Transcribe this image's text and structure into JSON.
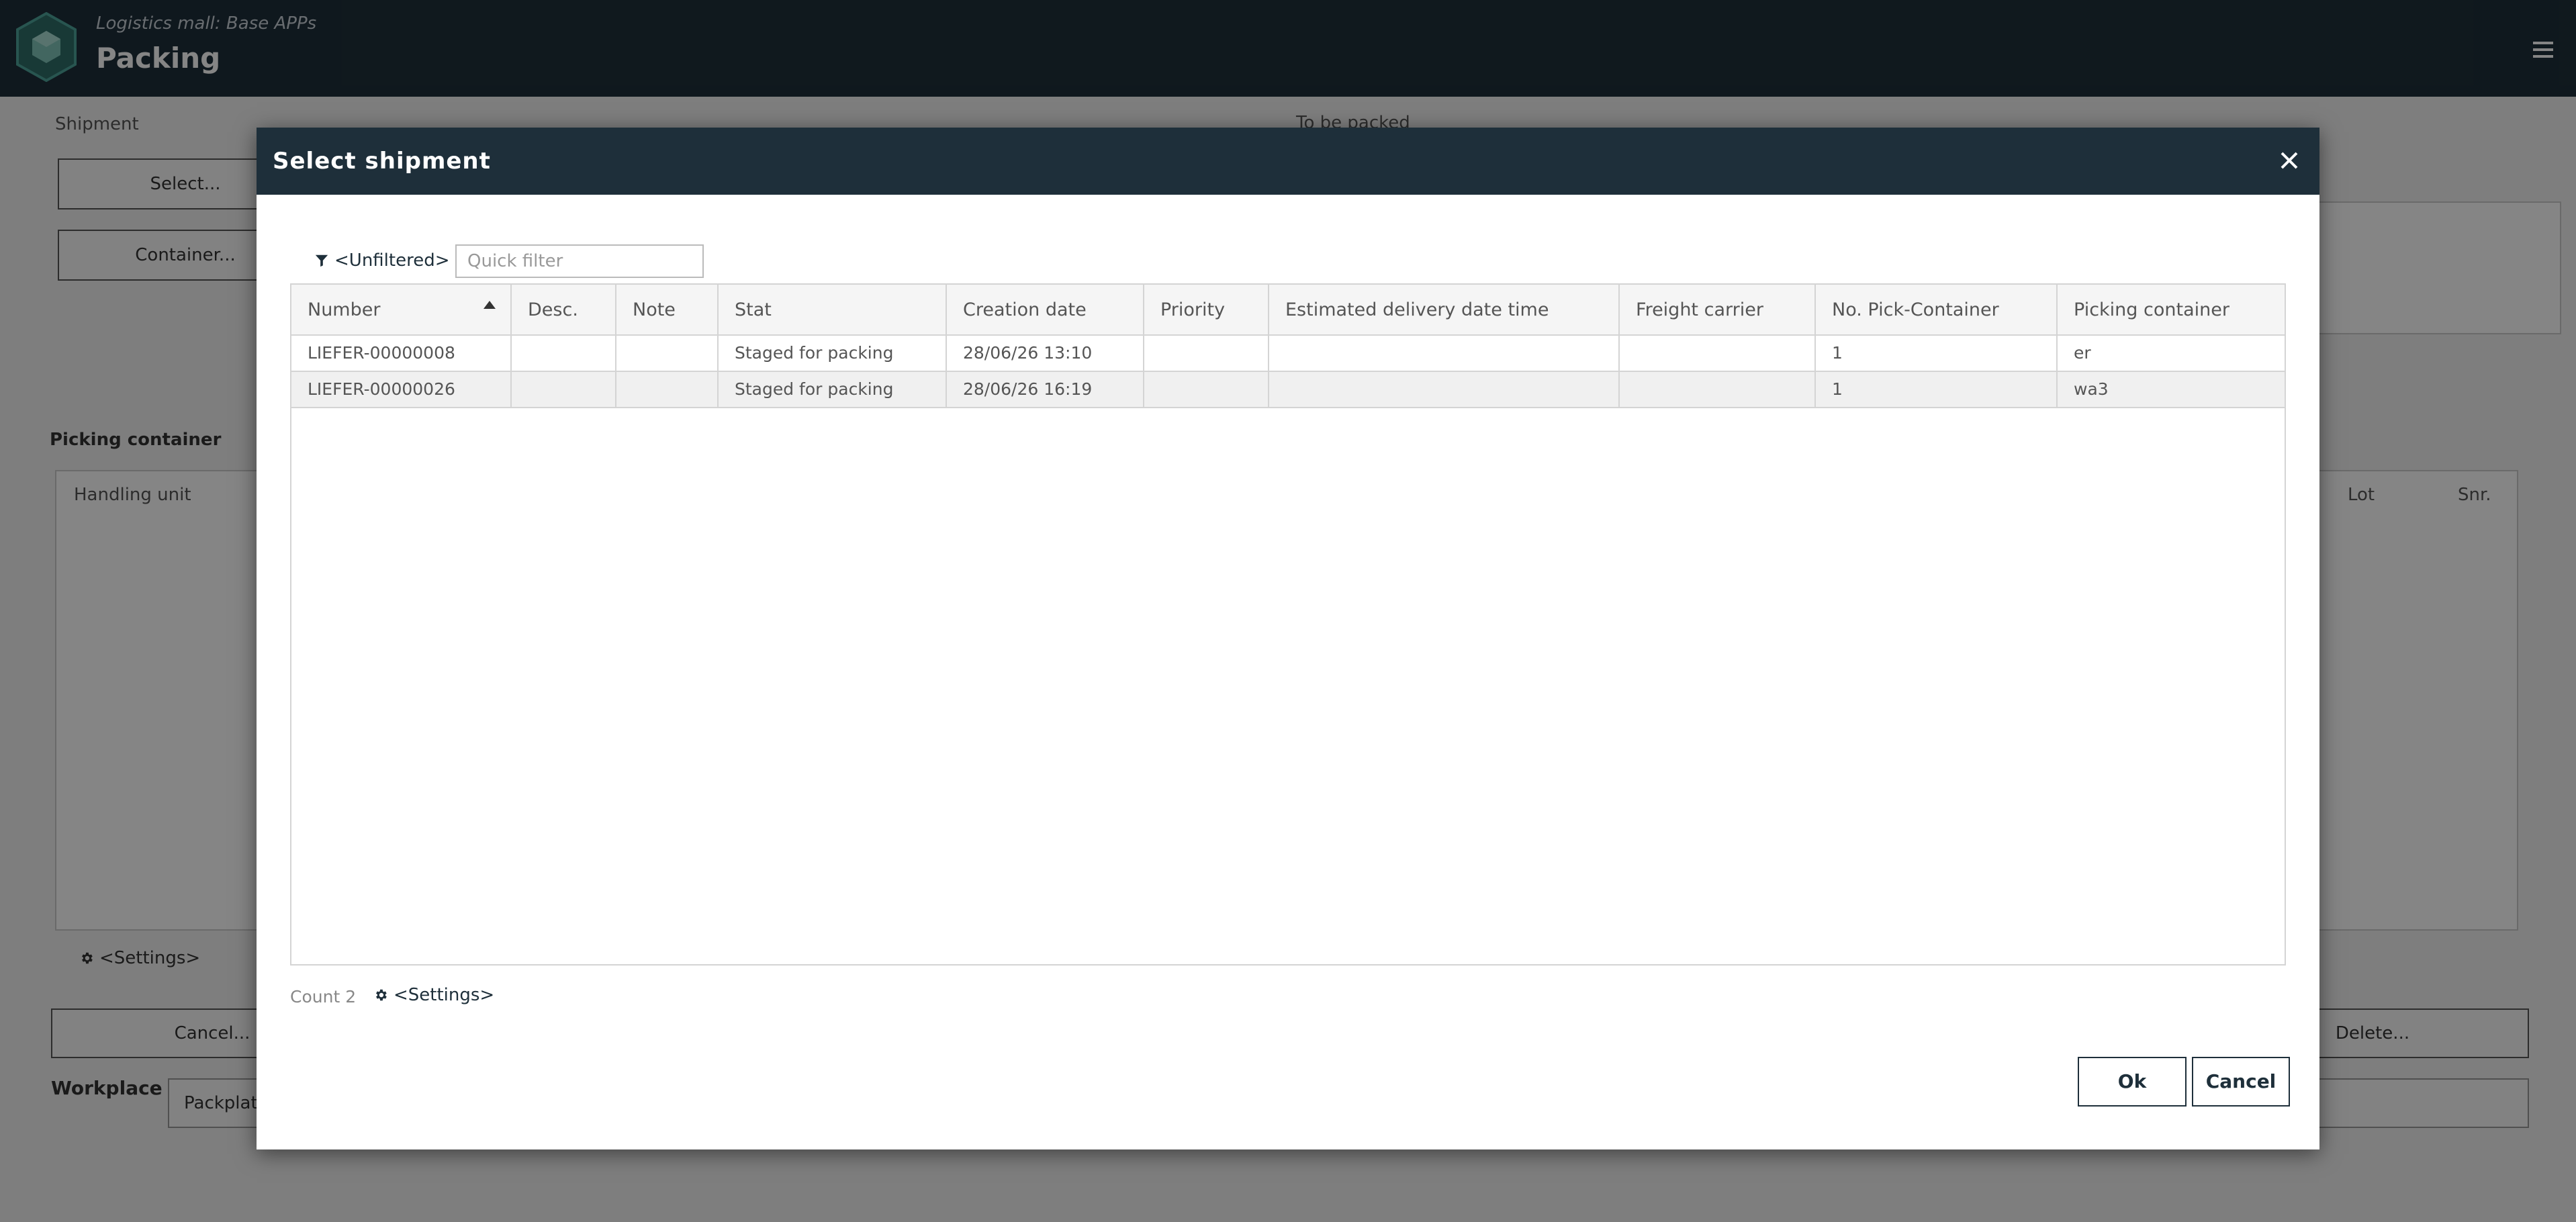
{
  "app": {
    "subtitle": "Logistics mall: Base APPs",
    "title": "Packing"
  },
  "background": {
    "shipment_label": "Shipment",
    "select_button": "Select...",
    "container_button": "Container...",
    "to_be_packed_label": "To be packed",
    "picking_container_label": "Picking container",
    "handling_unit_header": "Handling unit",
    "lot_header": "Lot",
    "snr_header": "Snr.",
    "settings_link": "<Settings>",
    "cancel_button": "Cancel...",
    "delete_button": "Delete...",
    "workplace_label": "Workplace",
    "workplace_value": "Packplatz"
  },
  "dialog": {
    "title": "Select shipment",
    "filter_label": "<Unfiltered>",
    "quick_filter_placeholder": "Quick filter",
    "columns": [
      "Number",
      "Desc.",
      "Note",
      "Stat",
      "Creation date",
      "Priority",
      "Estimated delivery date time",
      "Freight carrier",
      "No. Pick-Container",
      "Picking container"
    ],
    "rows": [
      [
        "LIEFER-00000008",
        "",
        "",
        "Staged for packing",
        "28/06/26 13:10",
        "",
        "",
        "",
        "1",
        "er"
      ],
      [
        "LIEFER-00000026",
        "",
        "",
        "Staged for packing",
        "28/06/26 16:19",
        "",
        "",
        "",
        "1",
        "wa3"
      ]
    ],
    "count_label": "Count 2",
    "settings_label": "<Settings>",
    "ok_button": "Ok",
    "cancel_button": "Cancel"
  },
  "icons": {
    "logo": "hexagon-box-logo",
    "menu": "hamburger-menu-icon",
    "close": "close-icon",
    "filter": "filter-funnel-icon",
    "settings": "gear-icon",
    "sort": "sort-ascending-icon"
  },
  "colors": {
    "header_bg": "#1e2f3a",
    "accent": "#1e2f3a",
    "logo": "#3a8a80"
  }
}
